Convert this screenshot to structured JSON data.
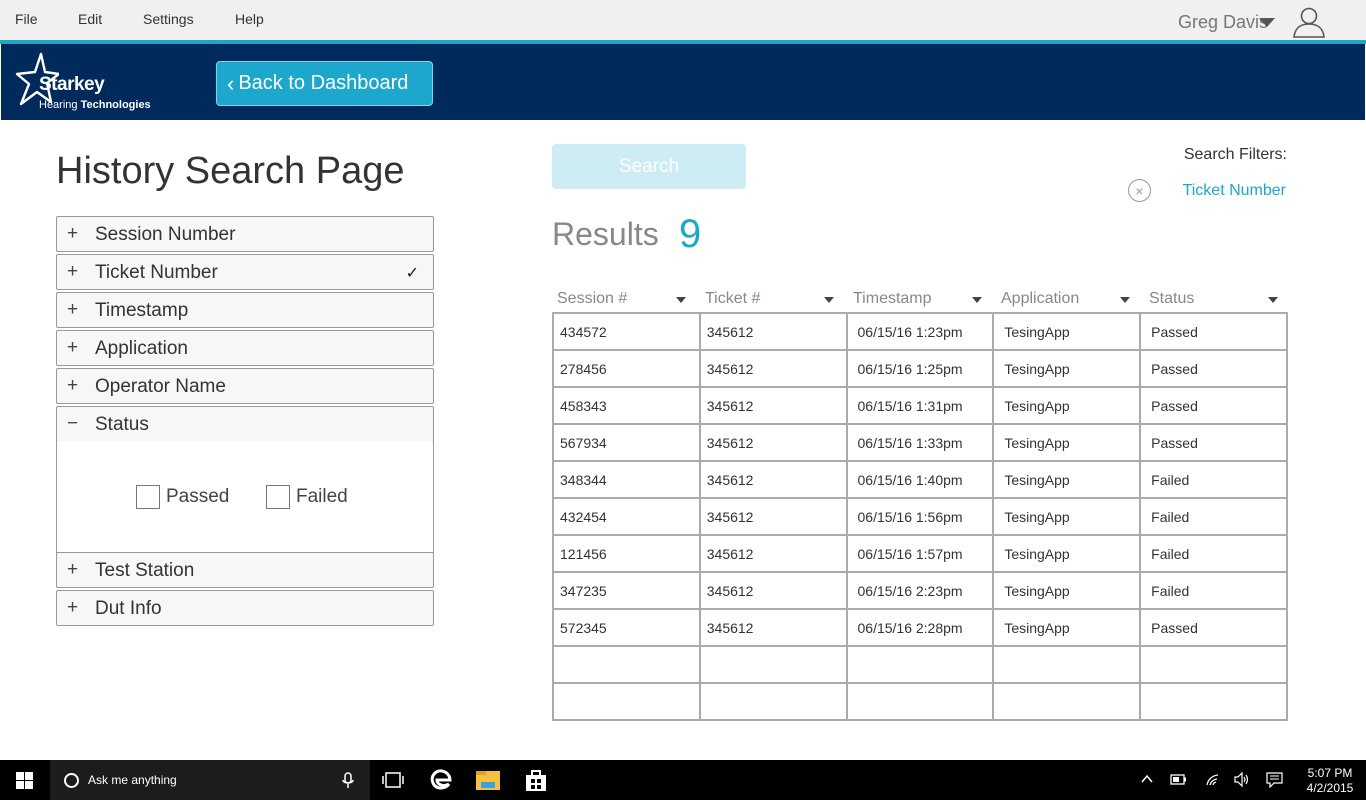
{
  "menu": {
    "file": "File",
    "edit": "Edit",
    "settings": "Settings",
    "help": "Help"
  },
  "user": {
    "name": "Greg Davis"
  },
  "header": {
    "brand": "Starkey",
    "brand_sub_1": "Hearing",
    "brand_sub_2": "Technologies",
    "back_button": "Back to Dashboard"
  },
  "page_title": "History Search Page",
  "filters": [
    {
      "label": "Session Number",
      "sign": "+"
    },
    {
      "label": "Ticket Number",
      "sign": "+",
      "checked_mark": "✓"
    },
    {
      "label": "Timestamp",
      "sign": "+"
    },
    {
      "label": "Application",
      "sign": "+"
    },
    {
      "label": "Operator Name",
      "sign": "+"
    },
    {
      "label": "Status",
      "sign": "−"
    },
    {
      "label": "Test Station",
      "sign": "+"
    },
    {
      "label": "Dut Info",
      "sign": "+"
    }
  ],
  "status_options": {
    "passed": "Passed",
    "failed": "Failed"
  },
  "search": {
    "button": "Search",
    "filters_label": "Search Filters:",
    "active_filter": "Ticket Number",
    "clear_icon": "×"
  },
  "results": {
    "label": "Results",
    "count": "9"
  },
  "table": {
    "headers": [
      "Session #",
      "Ticket #",
      "Timestamp",
      "Application",
      "Status"
    ],
    "rows": [
      [
        "434572",
        "345612",
        "06/15/16 1:23pm",
        "TesingApp",
        "Passed"
      ],
      [
        "278456",
        "345612",
        "06/15/16 1:25pm",
        "TesingApp",
        "Passed"
      ],
      [
        "458343",
        "345612",
        "06/15/16 1:31pm",
        "TesingApp",
        "Passed"
      ],
      [
        "567934",
        "345612",
        "06/15/16 1:33pm",
        "TesingApp",
        "Passed"
      ],
      [
        "348344",
        "345612",
        "06/15/16 1:40pm",
        "TesingApp",
        "Failed"
      ],
      [
        "432454",
        "345612",
        "06/15/16 1:56pm",
        "TesingApp",
        "Failed"
      ],
      [
        "121456",
        "345612",
        "06/15/16 1:57pm",
        "TesingApp",
        "Failed"
      ],
      [
        "347235",
        "345612",
        "06/15/16 2:23pm",
        "TesingApp",
        "Failed"
      ],
      [
        "572345",
        "345612",
        "06/15/16 2:28pm",
        "TesingApp",
        "Passed"
      ],
      [
        "",
        "",
        "",
        "",
        ""
      ],
      [
        "",
        "",
        "",
        "",
        ""
      ]
    ]
  },
  "taskbar": {
    "search_placeholder": "Ask me anything",
    "time": "5:07 PM",
    "date": "4/2/2015"
  },
  "colors": {
    "accent": "#1ea7cc",
    "header_bg": "#002a5c",
    "menubar_bg": "#f0f0f0"
  }
}
